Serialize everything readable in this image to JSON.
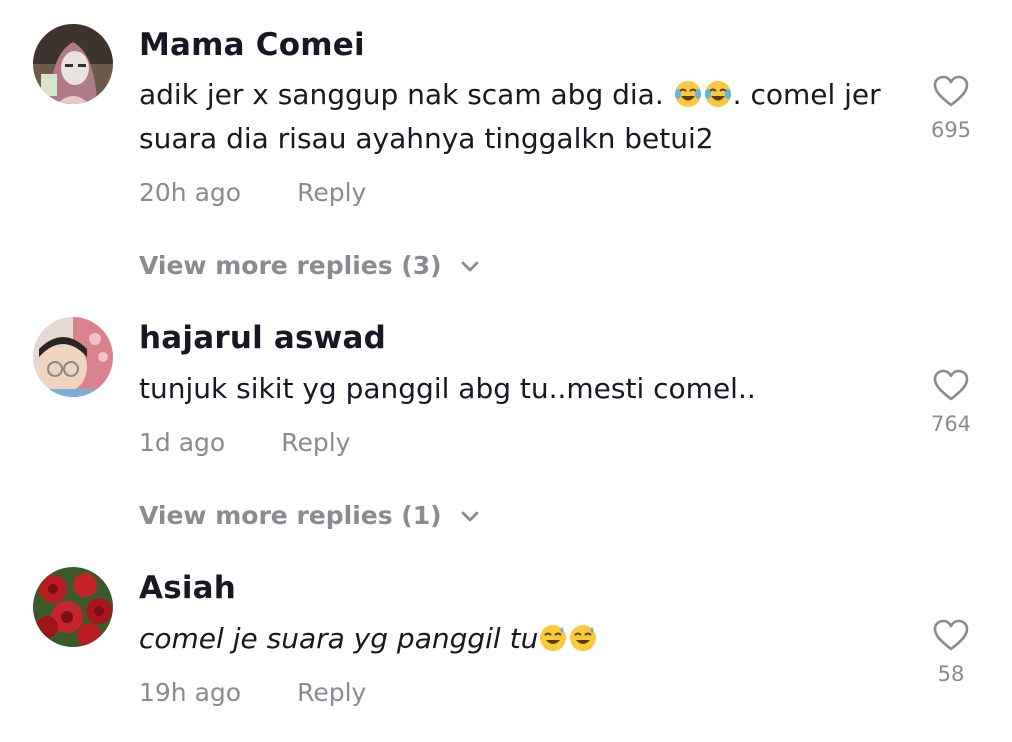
{
  "comments": [
    {
      "username": "Mama Comei",
      "text_before_emoji": "adik jer x sanggup nak scam abg dia. ",
      "emoji": [
        "joy-emoji",
        "joy-emoji"
      ],
      "text_after_emoji": ". comel jer",
      "text_line2": "suara dia risau ayahnya tinggalkn betui2",
      "time": "20h ago",
      "reply_label": "Reply",
      "likes": "695",
      "view_more": "View more replies (3)"
    },
    {
      "username": "hajarul aswad",
      "text": "tunjuk sikit yg panggil abg tu..mesti comel..",
      "time": "1d ago",
      "reply_label": "Reply",
      "likes": "764",
      "view_more": "View more replies (1)"
    },
    {
      "username": "Asiah",
      "text": "comel je suara yg panggil tu",
      "emoji": [
        "sweat-smile-emoji",
        "sweat-smile-emoji"
      ],
      "time": "19h ago",
      "reply_label": "Reply",
      "likes": "58"
    }
  ],
  "colors": {
    "primary_text": "#161823",
    "secondary_text": "#8a8b91",
    "background": "#ffffff"
  },
  "icons": {
    "like": "heart-outline-icon",
    "expand": "chevron-down-icon"
  }
}
